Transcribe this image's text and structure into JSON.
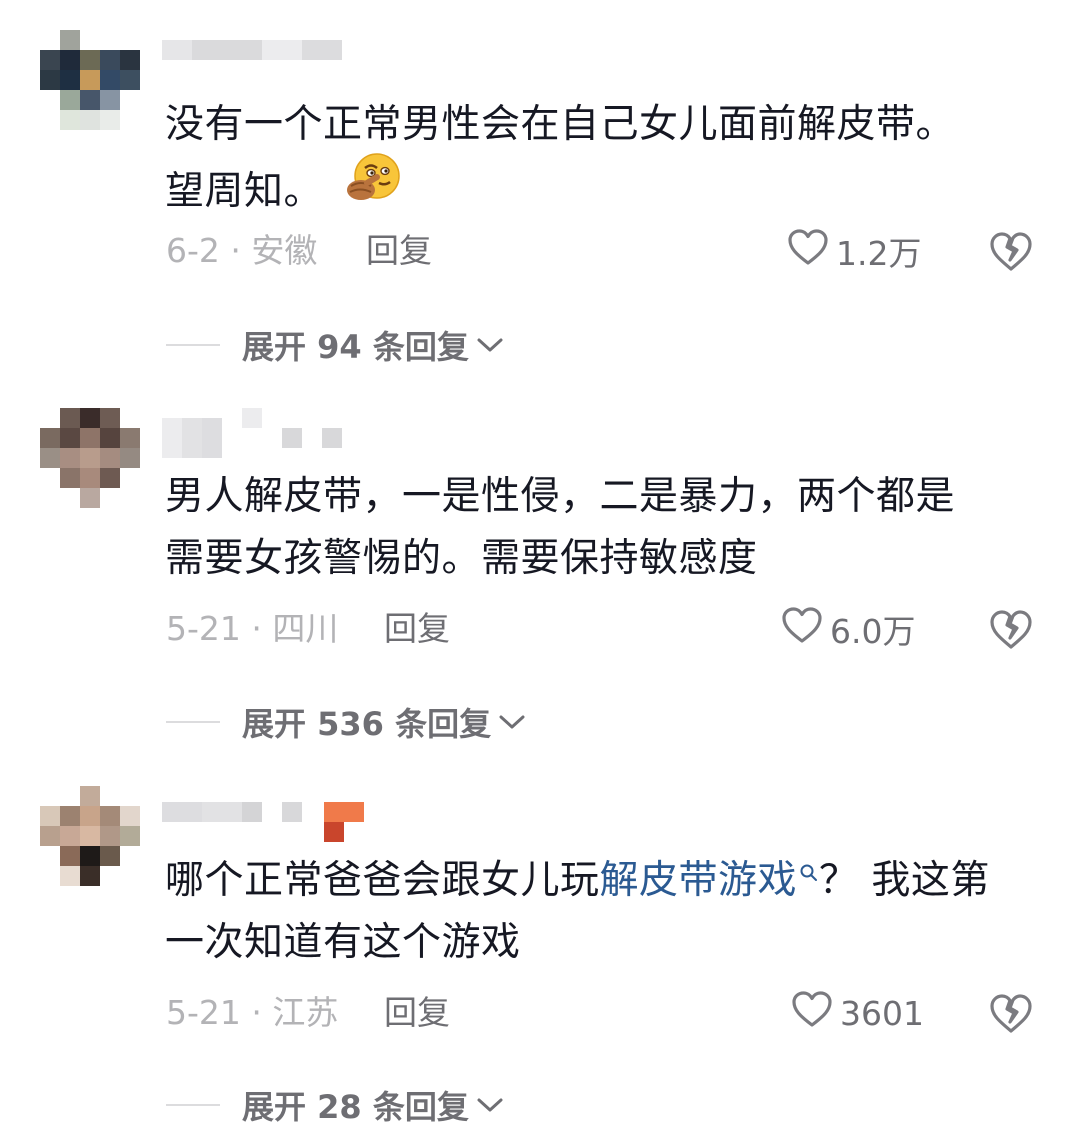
{
  "comments": [
    {
      "text_lines": [
        "没有一个正常男性会在自己女儿面前解皮带。",
        "望周知。"
      ],
      "emoji": "thinking-face-with-pointing-hand",
      "meta": "6-2 · 安徽",
      "reply_label": "回复",
      "likes": "1.2万",
      "expand_label": "展开 94 条回复"
    },
    {
      "text_lines": [
        "男人解皮带，一是性侵，二是暴力，两个都是",
        "需要女孩警惕的。需要保持敏感度"
      ],
      "meta": "5-21 · 四川",
      "reply_label": "回复",
      "likes": "6.0万",
      "expand_label": "展开 536 条回复"
    },
    {
      "text_before": "哪个正常爸爸会跟女儿玩",
      "hashtag": "解皮带游戏",
      "text_after": "？ 我这第",
      "text_line2": "一次知道有这个游戏",
      "meta": "5-21 · 江苏",
      "reply_label": "回复",
      "likes": "3601",
      "expand_label": "展开 28 条回复"
    }
  ],
  "icons": {
    "like": "heart-outline-icon",
    "dislike": "broken-heart-icon",
    "expand": "chevron-down-icon",
    "search": "search-icon"
  },
  "colors": {
    "text": "#161823",
    "meta": "#b3b3b6",
    "action": "#6e6e73",
    "hashtag": "#2b5a92"
  }
}
